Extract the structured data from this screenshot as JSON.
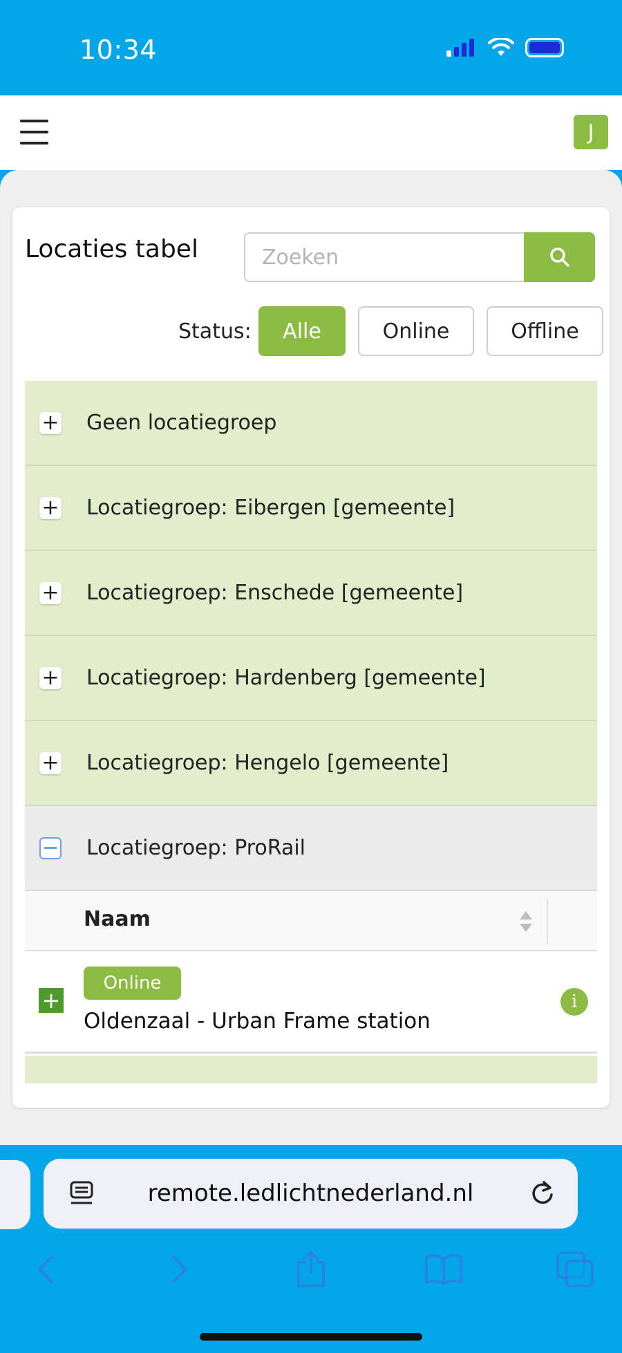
{
  "status_bar": {
    "time": "10:34"
  },
  "header": {
    "user_initial": "J"
  },
  "page": {
    "title": "Locaties tabel",
    "search_placeholder": "Zoeken",
    "status_label": "Status:",
    "filters": [
      "Alle",
      "Online",
      "Offline"
    ],
    "active_filter": "Alle"
  },
  "groups": [
    {
      "label": "Geen locatiegroep",
      "expanded": false
    },
    {
      "label": "Locatiegroep: Eibergen [gemeente]",
      "expanded": false
    },
    {
      "label": "Locatiegroep: Enschede [gemeente]",
      "expanded": false
    },
    {
      "label": "Locatiegroep: Hardenberg [gemeente]",
      "expanded": false
    },
    {
      "label": "Locatiegroep: Hengelo [gemeente]",
      "expanded": false
    },
    {
      "label": "Locatiegroep: ProRail",
      "expanded": true
    }
  ],
  "table": {
    "column_name": "Naam",
    "rows": [
      {
        "status": "Online",
        "name": "Oldenzaal - Urban Frame station"
      }
    ]
  },
  "browser": {
    "url": "remote.ledlichtnederland.nl"
  },
  "colors": {
    "brand_green": "#8CBB43",
    "browser_blue": "#03A6E8",
    "group_bg": "#E1EDCB"
  }
}
